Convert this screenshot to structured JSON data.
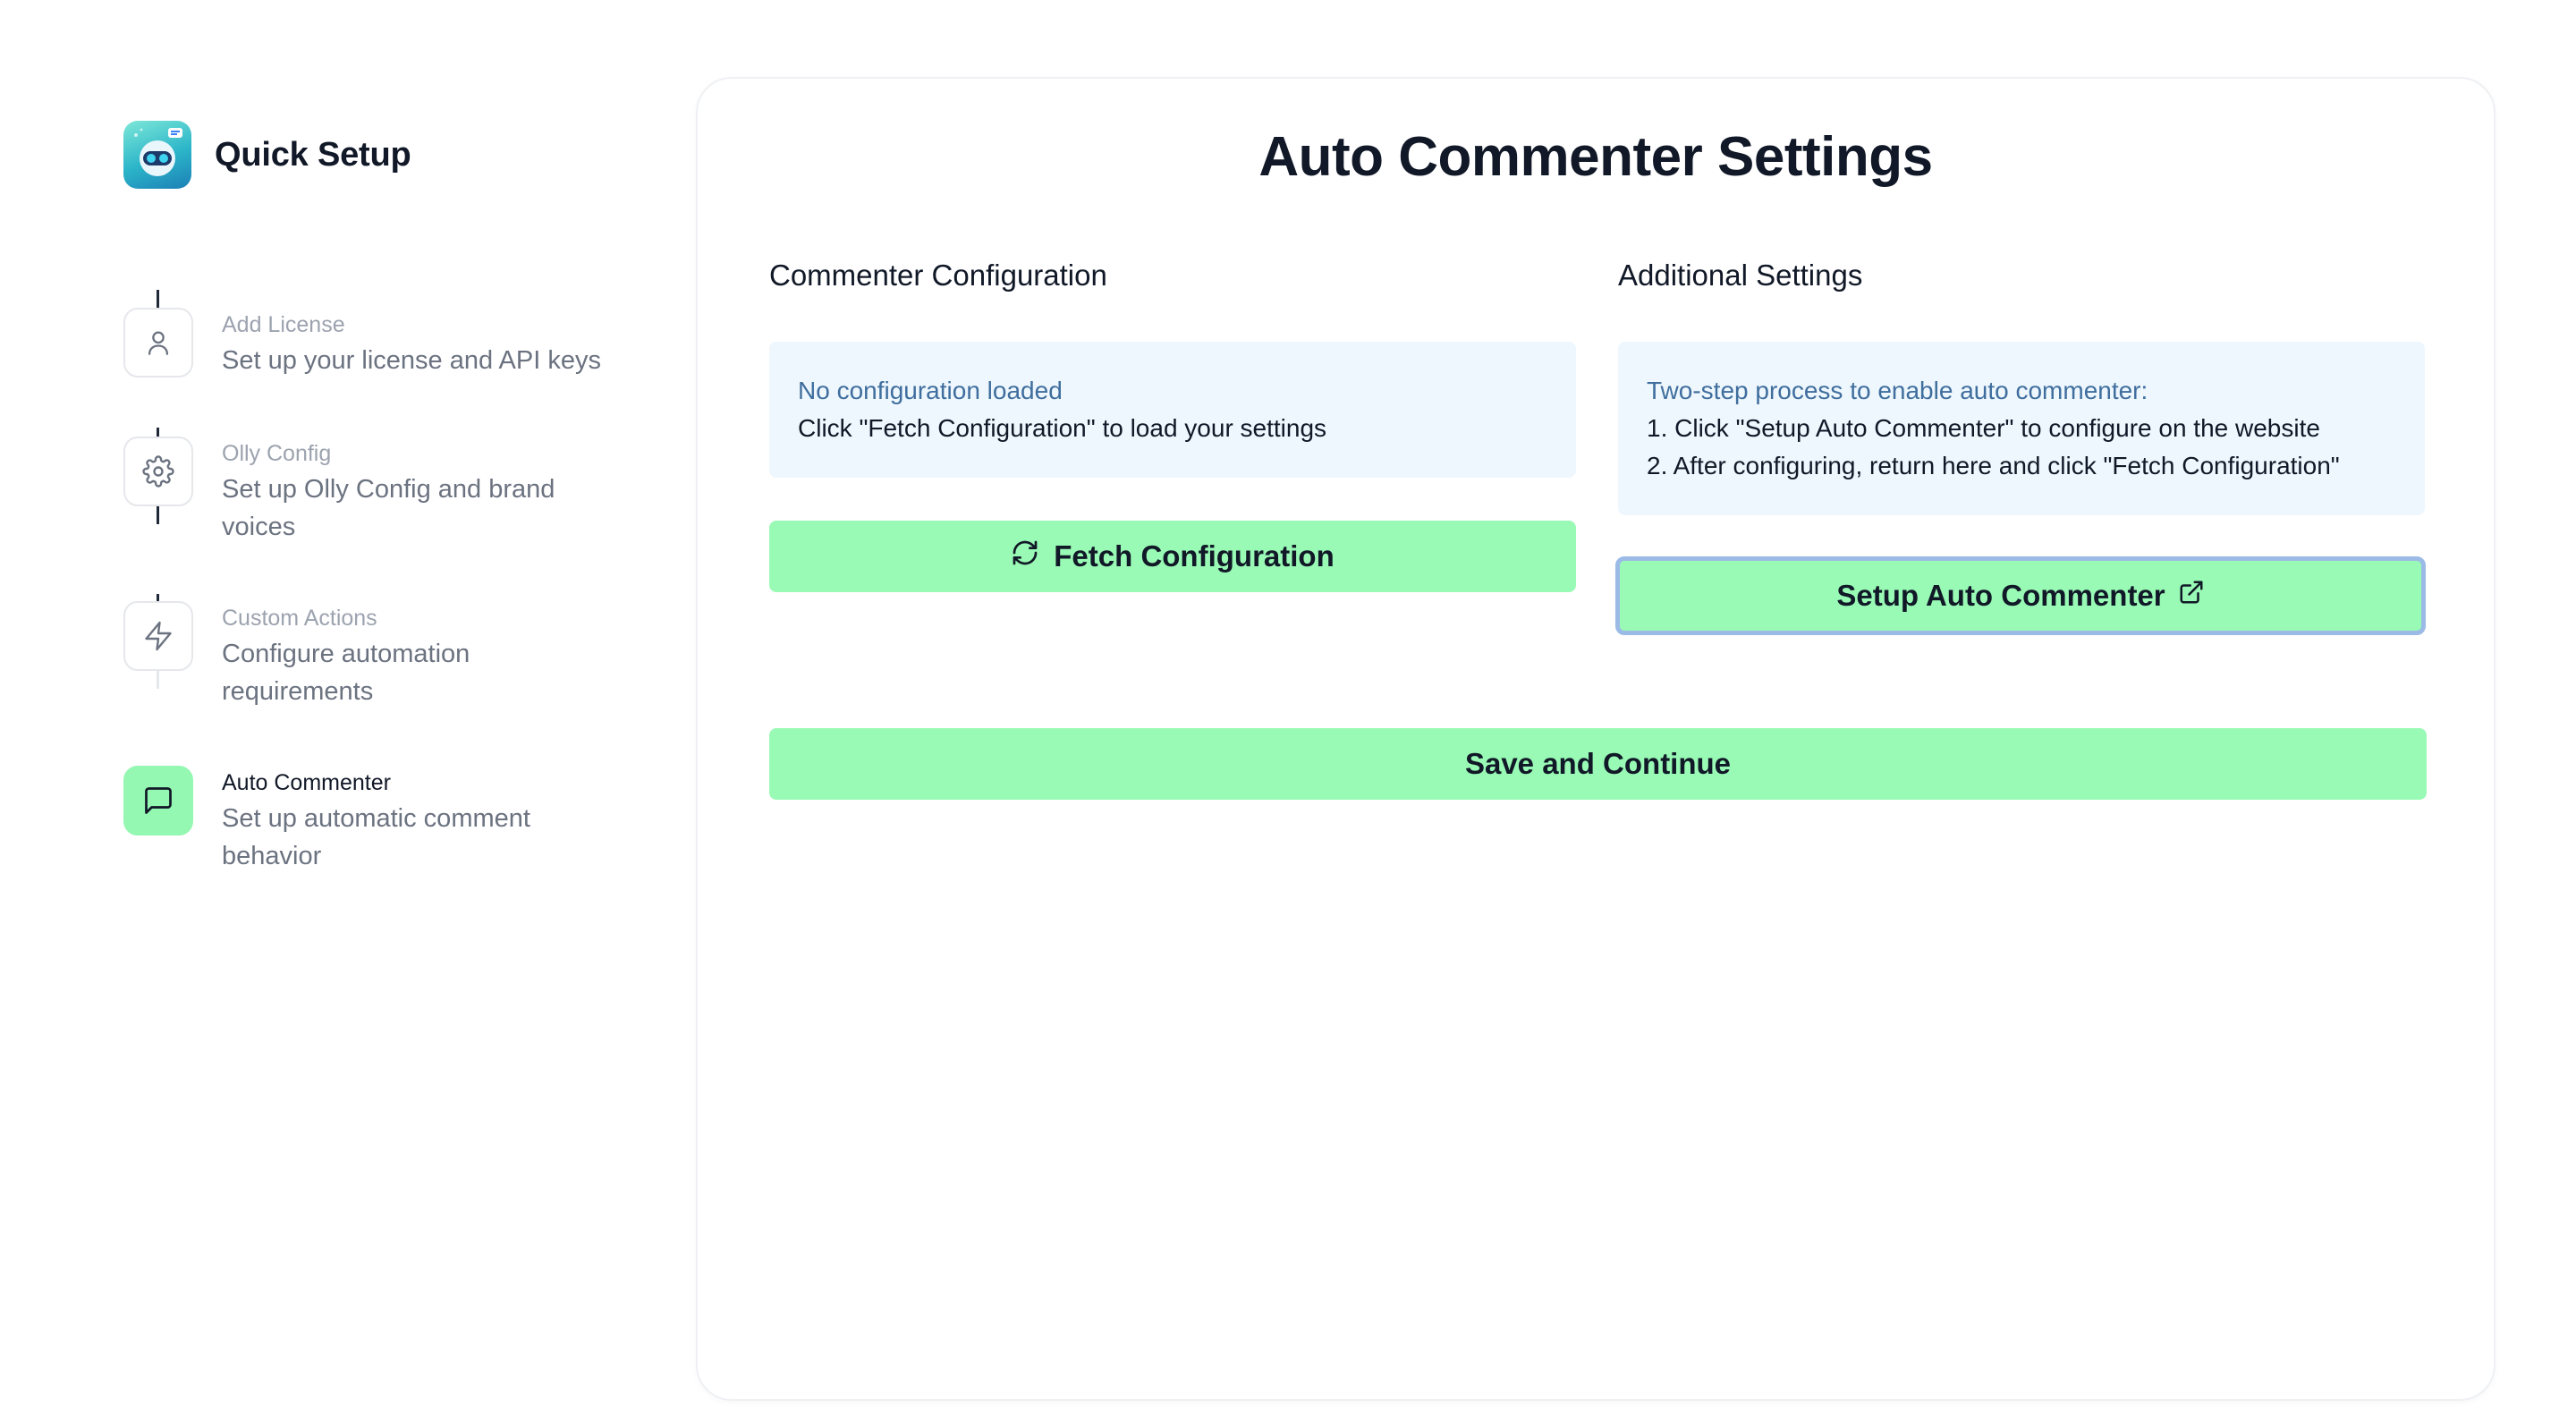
{
  "sidebar": {
    "title": "Quick Setup",
    "steps": [
      {
        "label": "Add License",
        "description": "Set up your license and API keys",
        "icon": "user-icon",
        "active": false
      },
      {
        "label": "Olly Config",
        "description": "Set up Olly Config and brand voices",
        "icon": "gear-icon",
        "active": false
      },
      {
        "label": "Custom Actions",
        "description": "Configure automation requirements",
        "icon": "lightning-icon",
        "active": false
      },
      {
        "label": "Auto Commenter",
        "description": "Set up automatic comment behavior",
        "icon": "message-square-icon",
        "active": true
      }
    ]
  },
  "main": {
    "title": "Auto Commenter Settings",
    "commenter": {
      "heading": "Commenter Configuration",
      "status_title": "No configuration loaded",
      "status_text": "Click \"Fetch Configuration\" to load your settings",
      "fetch_label": "Fetch Configuration"
    },
    "additional": {
      "heading": "Additional Settings",
      "info_title": "Two-step process to enable auto commenter:",
      "step1": "1. Click \"Setup Auto Commenter\" to configure on the website",
      "step2": "2. After configuring, return here and click \"Fetch Configuration\"",
      "setup_label": "Setup Auto Commenter"
    },
    "save_label": "Save and Continue"
  },
  "colors": {
    "accent": "#98fab4",
    "info_bg": "#eef7fd",
    "info_title": "#3f6e9e",
    "focus_ring": "#9bbbe6"
  }
}
